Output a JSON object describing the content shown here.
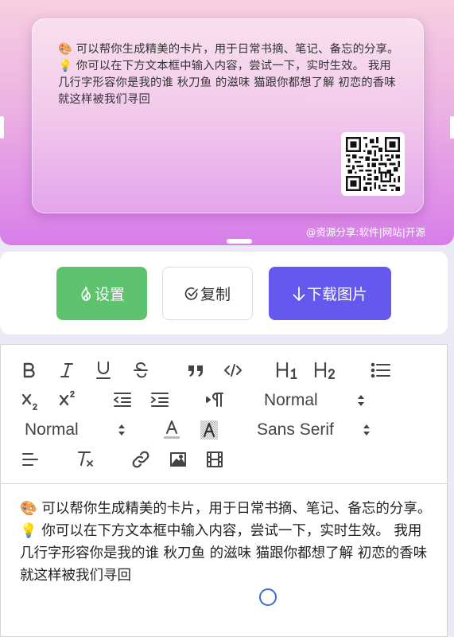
{
  "preview": {
    "card_text": "🎨 可以帮你生成精美的卡片，用于日常书摘、笔记、备忘的分享。 💡 你可以在下方文本框中输入内容，尝试一下，实时生效。 我用几行字形容你是我的谁 秋刀鱼 的滋味 猫跟你都想了解 初恋的香味就这样被我们寻回",
    "watermark": "@资源分享:软件|网站|开源",
    "gradient_colors": [
      "#f6cfe0",
      "#ecb1e3",
      "#d77ee9"
    ]
  },
  "actions": {
    "settings_label": "设置",
    "copy_label": "复制",
    "download_label": "下载图片",
    "settings_color": "#5ec36f",
    "download_color": "#6558ef"
  },
  "toolbar": {
    "header_picker": "Normal",
    "size_picker": "Normal",
    "font_picker": "Sans Serif",
    "icons": [
      "bold-icon",
      "italic-icon",
      "underline-icon",
      "strikethrough-icon",
      "blockquote-icon",
      "code-block-icon",
      "header1-icon",
      "header2-icon",
      "bullet-list-icon",
      "subscript-icon",
      "superscript-icon",
      "outdent-icon",
      "indent-icon",
      "rtl-direction-icon",
      "font-color-icon",
      "background-color-icon",
      "align-left-icon",
      "clear-format-icon",
      "link-icon",
      "image-icon",
      "video-icon"
    ]
  },
  "editor": {
    "content": "🎨 可以帮你生成精美的卡片，用于日常书摘、笔记、备忘的分享。 💡 你可以在下方文本框中输入内容，尝试一下，实时生效。 我用几行字形容你是我的谁 秋刀鱼 的滋味 猫跟你都想了解 初恋的香味就这样被我们寻回"
  }
}
